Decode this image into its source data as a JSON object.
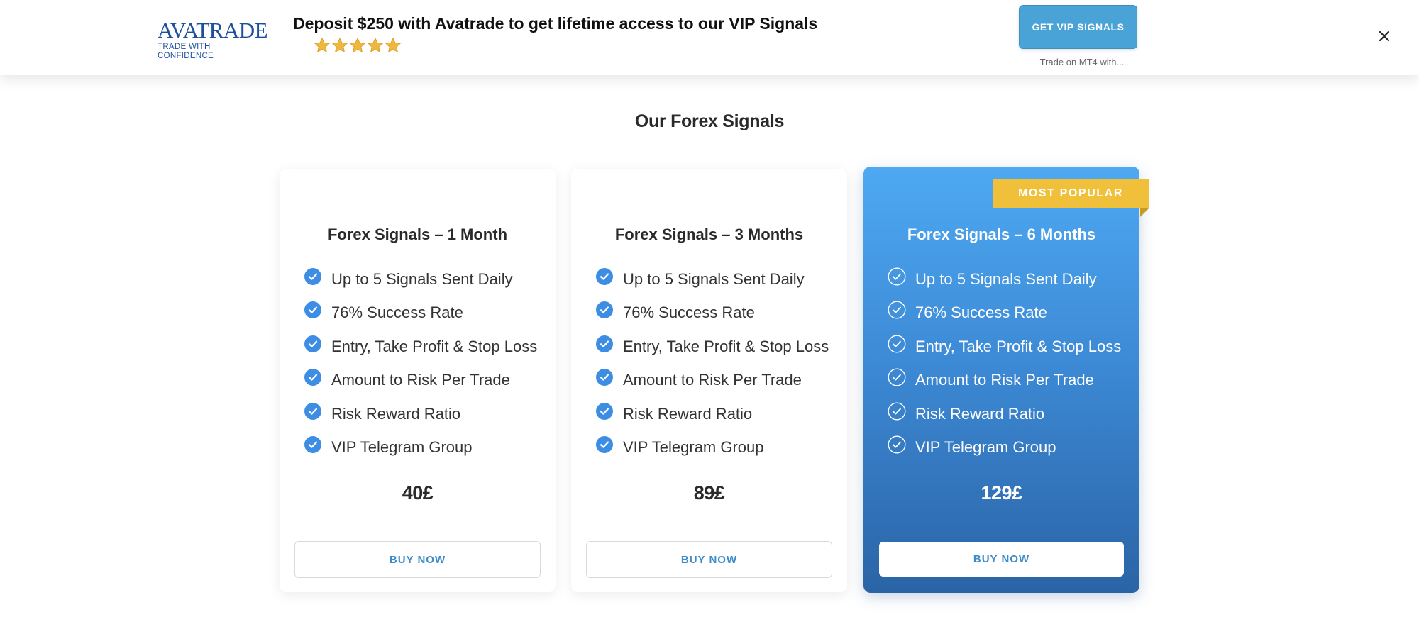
{
  "banner": {
    "logo_text": "AVATRADE",
    "logo_tagline": "TRADE WITH CONFIDENCE",
    "headline": "Deposit $250 with Avatrade to get lifetime access to our VIP Signals",
    "rating_stars": 5,
    "cta_label": "GET VIP SIGNALS",
    "cta_subtext": "Trade on MT4 with...",
    "star_color": "#f0b73e",
    "cta_color": "#4aa3d6"
  },
  "section": {
    "title": "Our Forex Signals"
  },
  "plans": [
    {
      "title": "Forex Signals – 1 Month",
      "features": [
        "Up to 5 Signals Sent Daily",
        "76% Success Rate",
        "Entry, Take Profit & Stop Loss",
        "Amount to Risk Per Trade",
        "Risk Reward Ratio",
        "VIP Telegram Group"
      ],
      "price": "40£",
      "button": "BUY NOW"
    },
    {
      "title": "Forex Signals – 3 Months",
      "features": [
        "Up to 5 Signals Sent Daily",
        "76% Success Rate",
        "Entry, Take Profit & Stop Loss",
        "Amount to Risk Per Trade",
        "Risk Reward Ratio",
        "VIP Telegram Group"
      ],
      "price": "89£",
      "button": "BUY NOW"
    },
    {
      "title": "Forex Signals – 6 Months",
      "badge": "MOST POPULAR",
      "features": [
        "Up to 5 Signals Sent Daily",
        "76% Success Rate",
        "Entry, Take Profit & Stop Loss",
        "Amount to Risk Per Trade",
        "Risk Reward Ratio",
        "VIP Telegram Group"
      ],
      "price": "129£",
      "button": "BUY NOW"
    }
  ],
  "colors": {
    "accent_blue": "#3d8bc8",
    "featured_gradient_top": "#4ea9f2",
    "featured_gradient_bottom": "#2a64a6",
    "badge": "#f0c03a"
  },
  "icons": {
    "feature_check": "check-circle-icon",
    "close": "close-icon",
    "star": "star-icon"
  }
}
